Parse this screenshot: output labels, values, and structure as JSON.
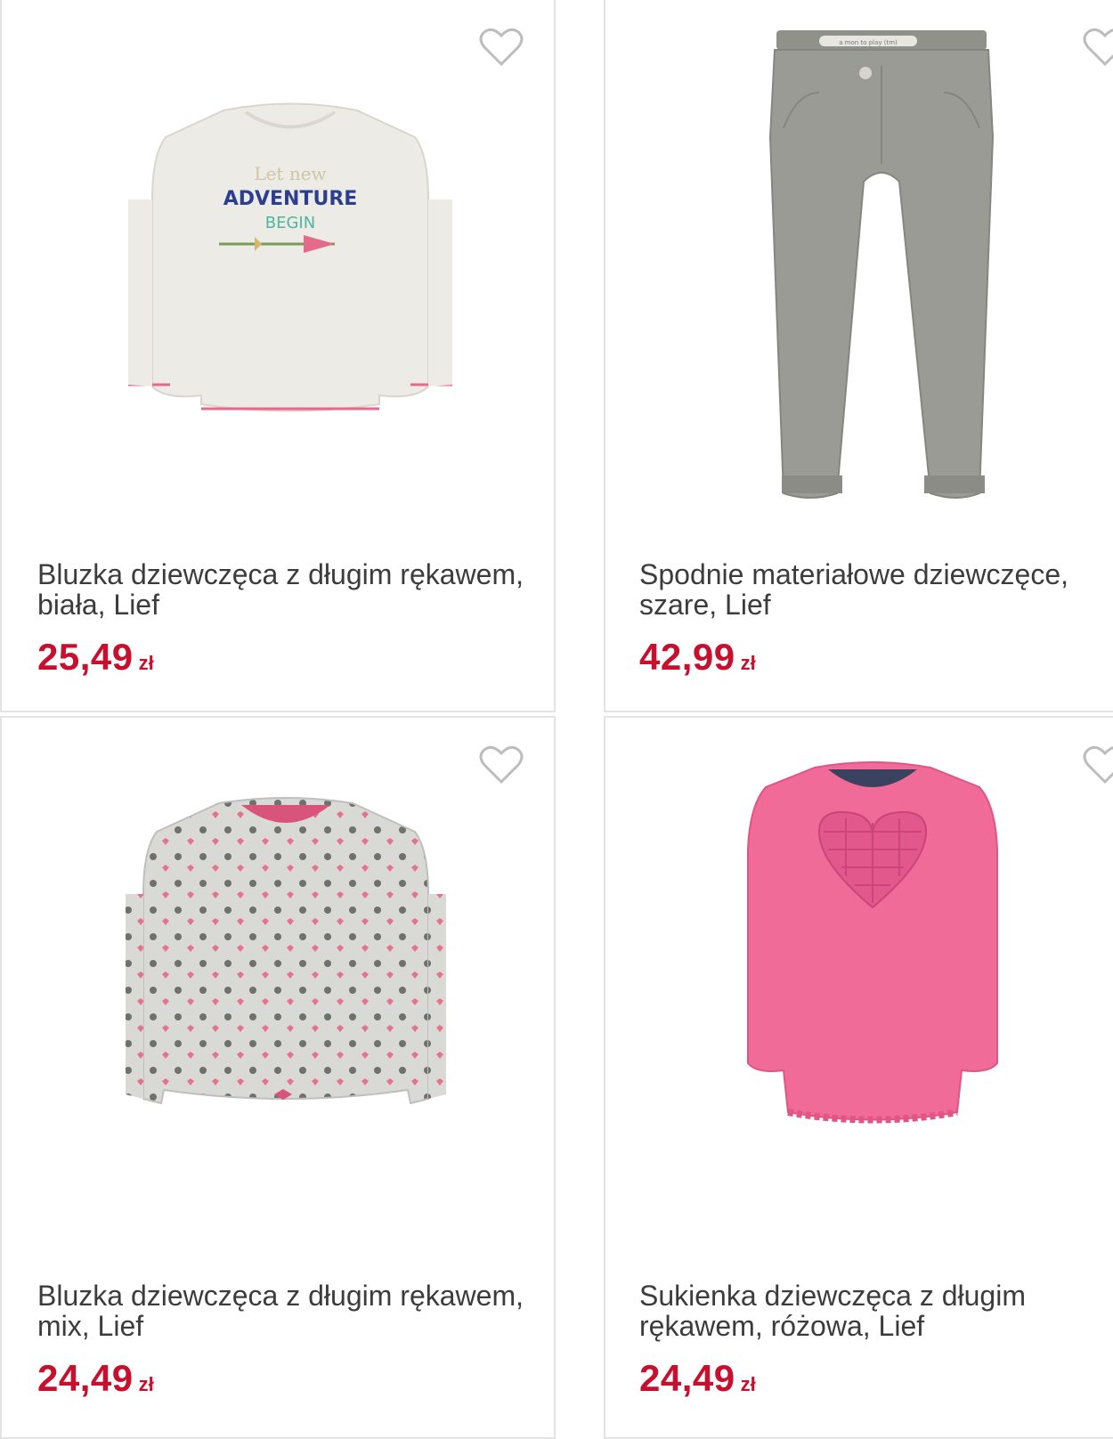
{
  "products": [
    {
      "name": "Bluzka dziewczęca z długim rękawem, biała, Lief",
      "price": "25,49",
      "currency": "zł",
      "image_text": [
        "Let new",
        "ADVENTURE",
        "BEGIN"
      ],
      "favorite_icon": "heart-outline-icon"
    },
    {
      "name": "Spodnie materiałowe dziewczęce, szare, Lief",
      "price": "42,99",
      "currency": "zł",
      "image_text": [
        "a mon to play (tm)"
      ],
      "favorite_icon": "heart-outline-icon"
    },
    {
      "name": "Bluzka dziewczęca z długim rękawem, mix, Lief",
      "price": "24,49",
      "currency": "zł",
      "favorite_icon": "heart-outline-icon"
    },
    {
      "name": "Sukienka dziewczęca z długim rękawem, różowa, Lief",
      "price": "24,49",
      "currency": "zł",
      "favorite_icon": "heart-outline-icon"
    }
  ],
  "colors": {
    "price": "#c8102e",
    "text": "#3c3c3c",
    "border": "#e3e3e3",
    "heart": "#bdbdbd"
  }
}
